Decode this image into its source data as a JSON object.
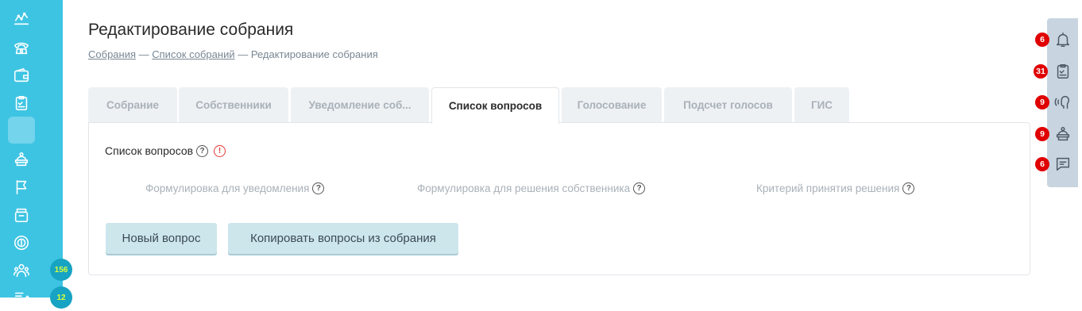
{
  "page": {
    "title": "Редактирование собрания",
    "breadcrumb": {
      "link1": "Собрания",
      "sep1": " — ",
      "link2": "Список собраний",
      "sep2": " — ",
      "current": "Редактирование собрания"
    }
  },
  "tabs": [
    {
      "label": "Собрание",
      "active": false
    },
    {
      "label": "Собственники",
      "active": false
    },
    {
      "label": "Уведомление соб...",
      "active": false
    },
    {
      "label": "Список вопросов",
      "active": true
    },
    {
      "label": "Голосование",
      "active": false
    },
    {
      "label": "Подсчет голосов",
      "active": false
    },
    {
      "label": "ГИС",
      "active": false
    }
  ],
  "panel": {
    "heading": "Список вопросов",
    "help_glyph": "?",
    "warning_glyph": "!",
    "columns": [
      "Формулировка для уведомления",
      "Формулировка для решения собственника",
      "Критерий принятия решения"
    ],
    "buttons": {
      "new_question": "Новый вопрос",
      "copy_questions": "Копировать вопросы из собрания"
    }
  },
  "sidebar": {
    "items": [
      {
        "icon": "analytics-icon"
      },
      {
        "icon": "phone-icon"
      },
      {
        "icon": "wallet-icon"
      },
      {
        "icon": "checklist-icon"
      },
      {
        "icon": "blank-active-icon",
        "active": true
      },
      {
        "icon": "reception-icon"
      },
      {
        "icon": "flag-icon"
      },
      {
        "icon": "archive-icon"
      },
      {
        "icon": "coin-icon"
      },
      {
        "icon": "people-icon",
        "badge": "156"
      },
      {
        "icon": "edit-icon",
        "badge": "12"
      }
    ]
  },
  "rightbar": {
    "items": [
      {
        "icon": "bell-icon",
        "badge": "6"
      },
      {
        "icon": "clipboard-check-icon",
        "badge": "31"
      },
      {
        "icon": "voice-icon",
        "badge": "9"
      },
      {
        "icon": "reception-desk-icon",
        "badge": "9"
      },
      {
        "icon": "chat-icon",
        "badge": "6"
      }
    ]
  },
  "colors": {
    "sidebar": "#3ec4e3",
    "sidebar_badge_bg": "#17a3c3",
    "sidebar_badge_text": "#d8ff3a",
    "right_badge": "#e00000",
    "button_bg": "#cde6ec",
    "warning": "#e53935"
  }
}
